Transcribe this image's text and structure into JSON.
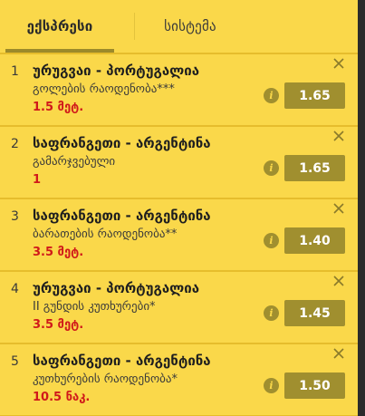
{
  "tabs": [
    {
      "label": "ექსპრესი",
      "active": true
    },
    {
      "label": "სისტემა",
      "active": false
    }
  ],
  "bets": [
    {
      "num": "1",
      "match": "ურუგვაი - პორტუგალია",
      "market": "გოლების რაოდენობა***",
      "pick": "1.5 მეტ.",
      "odds": "1.65"
    },
    {
      "num": "2",
      "match": "საფრანგეთი - არგენტინა",
      "market": "გამარჯვებული",
      "pick": "1",
      "odds": "1.65"
    },
    {
      "num": "3",
      "match": "საფრანგეთი - არგენტინა",
      "market": "ბარათების რაოდენობა**",
      "pick": "3.5 მეტ.",
      "odds": "1.40"
    },
    {
      "num": "4",
      "match": "ურუგვაი - პორტუგალია",
      "market": "II გუნდის კუთხურები*",
      "pick": "3.5 მეტ.",
      "odds": "1.45"
    },
    {
      "num": "5",
      "match": "საფრანგეთი - არგენტინა",
      "market": "კუთხურების რაოდენობა*",
      "pick": "10.5 ნაკ.",
      "odds": "1.50"
    }
  ],
  "icons": {
    "close": "close-icon",
    "info": "info-icon"
  },
  "colors": {
    "panel": "#fad84a",
    "accent": "#a08f2f",
    "pick": "#d0191a"
  }
}
